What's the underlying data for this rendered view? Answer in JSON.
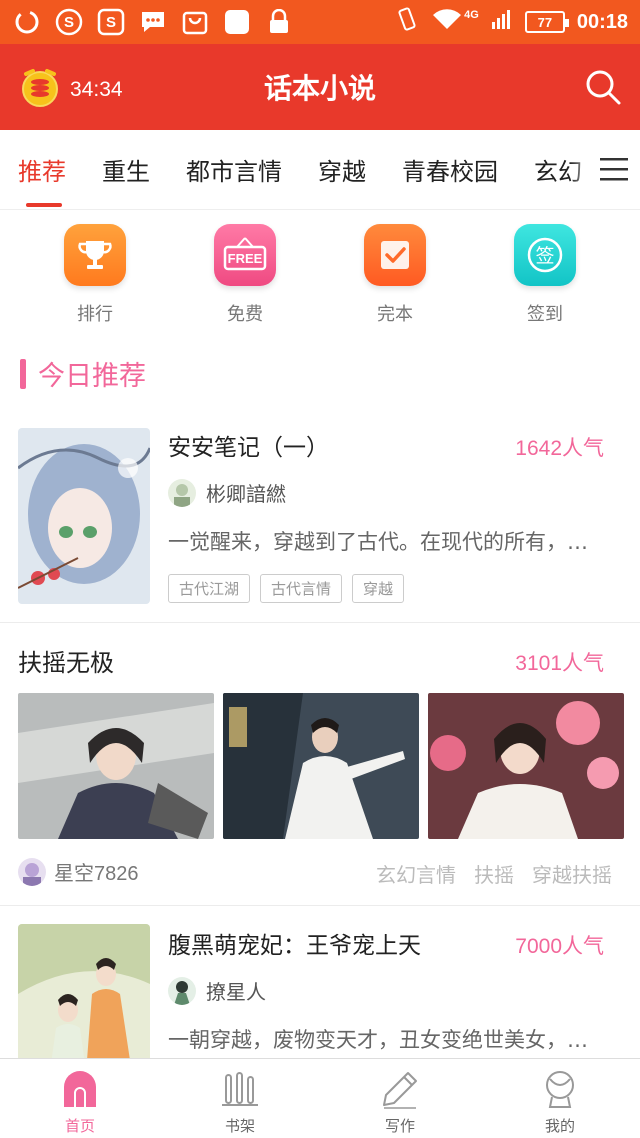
{
  "status_bar": {
    "network": "4G",
    "battery": "77",
    "time": "00:18"
  },
  "header": {
    "coin_count": "34:34",
    "title": "话本小说"
  },
  "tabs": [
    {
      "label": "推荐",
      "active": true
    },
    {
      "label": "重生"
    },
    {
      "label": "都市言情"
    },
    {
      "label": "穿越"
    },
    {
      "label": "青春校园"
    },
    {
      "label": "玄幻"
    }
  ],
  "quick_entries": [
    {
      "label": "排行",
      "icon": "trophy-icon",
      "color": "#ff8a2a"
    },
    {
      "label": "免费",
      "icon": "free-icon",
      "color": "#f25a8c",
      "icon_text": "FREE"
    },
    {
      "label": "完本",
      "icon": "check-icon",
      "color": "#ff6a2a"
    },
    {
      "label": "签到",
      "icon": "signin-icon",
      "color": "#1fd0d0",
      "icon_text": "签"
    }
  ],
  "section": {
    "title": "今日推荐"
  },
  "books": [
    {
      "title": "安安笔记（一）",
      "heat": "1642人气",
      "author": "彬卿諳繎",
      "desc": "一觉醒来，穿越到了古代。在现代的所有，…",
      "tags": [
        "古代江湖",
        "古代言情",
        "穿越"
      ]
    },
    {
      "title": "腹黑萌宠妃：王爷宠上天",
      "heat": "7000人气",
      "author": "撩星人",
      "desc": "一朝穿越，废物变天才，丑女变绝世美女，…"
    }
  ],
  "post": {
    "title": "扶摇无极",
    "heat": "3101人气",
    "user": "星空7826",
    "tags": [
      "玄幻言情",
      "扶摇",
      "穿越扶摇"
    ]
  },
  "bottom_nav": [
    {
      "label": "首页",
      "icon": "home-icon",
      "active": true
    },
    {
      "label": "书架",
      "icon": "bookshelf-icon"
    },
    {
      "label": "写作",
      "icon": "pen-icon"
    },
    {
      "label": "我的",
      "icon": "profile-icon"
    }
  ],
  "colors": {
    "status_bar": "#f2581f",
    "header": "#e8392b",
    "accent_pink": "#f2679a"
  }
}
